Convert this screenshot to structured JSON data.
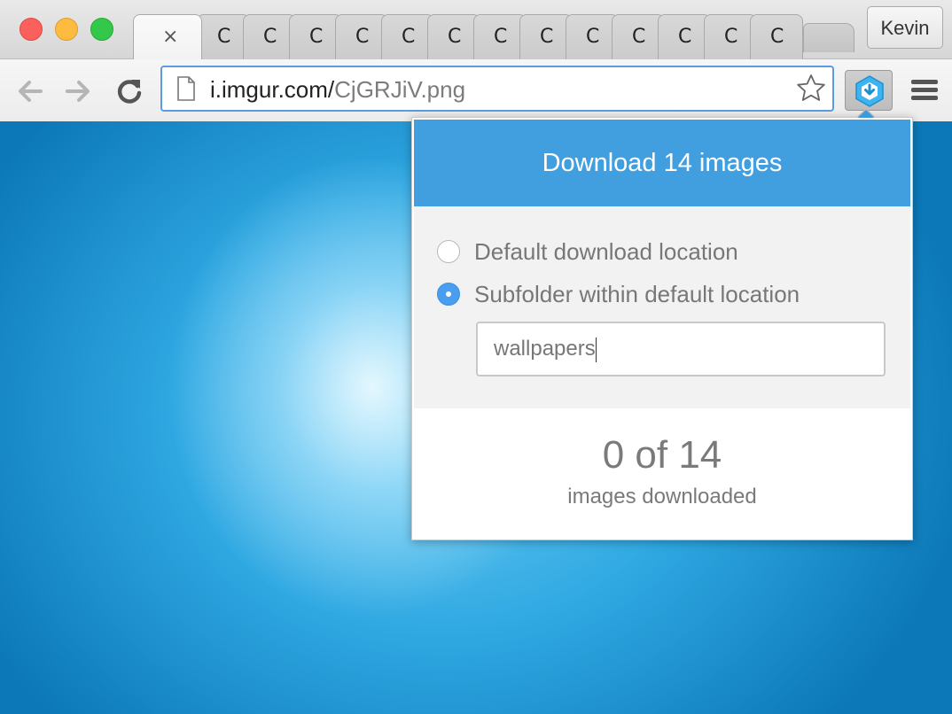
{
  "window": {
    "profile_name": "Kevin"
  },
  "tabs": {
    "active_close_glyph": "×",
    "mini_tab_favicon": "C",
    "mini_tab_count": 13
  },
  "toolbar": {
    "url_host": "i.imgur.com/",
    "url_path": "CjGRJiV.png"
  },
  "popup": {
    "download_button_label": "Download 14 images",
    "options": [
      {
        "label": "Default download location",
        "selected": false
      },
      {
        "label": "Subfolder within default location",
        "selected": true
      }
    ],
    "subfolder_value": "wallpapers",
    "progress_count": "0 of 14",
    "progress_label": "images downloaded"
  },
  "colors": {
    "accent": "#419fdf",
    "radio_selected": "#4a9ef0"
  }
}
